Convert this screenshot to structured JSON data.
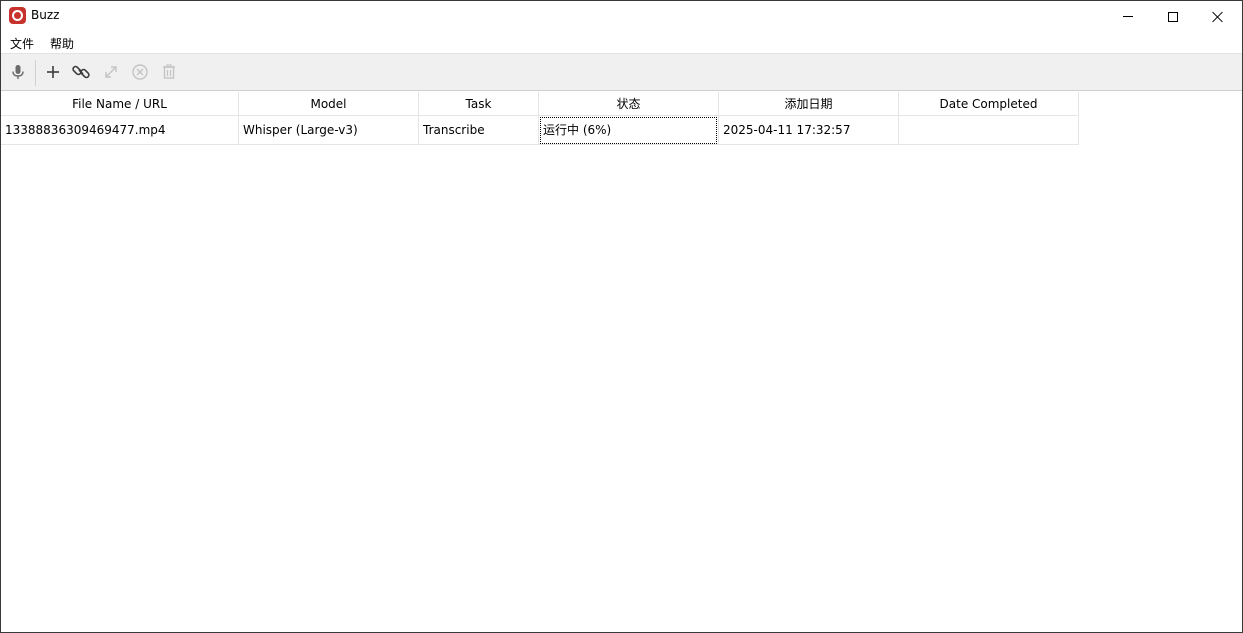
{
  "window": {
    "title": "Buzz",
    "icon": "buzz-app-icon",
    "accent_color": "#c8322c"
  },
  "menu": {
    "file": "文件",
    "help": "帮助"
  },
  "toolbar": {
    "icons": [
      "microphone-icon",
      "plus-icon",
      "link-icon",
      "expand-icon",
      "cancel-icon",
      "trash-icon"
    ]
  },
  "table": {
    "columns": [
      "File Name / URL",
      "Model",
      "Task",
      "状态",
      "添加日期",
      "Date Completed"
    ],
    "rows": [
      {
        "file": "13388836309469477.mp4",
        "model": "Whisper (Large-v3)",
        "task": "Transcribe",
        "status": "运行中 (6%)",
        "added": "2025-04-11 17:32:57",
        "completed": ""
      }
    ]
  }
}
